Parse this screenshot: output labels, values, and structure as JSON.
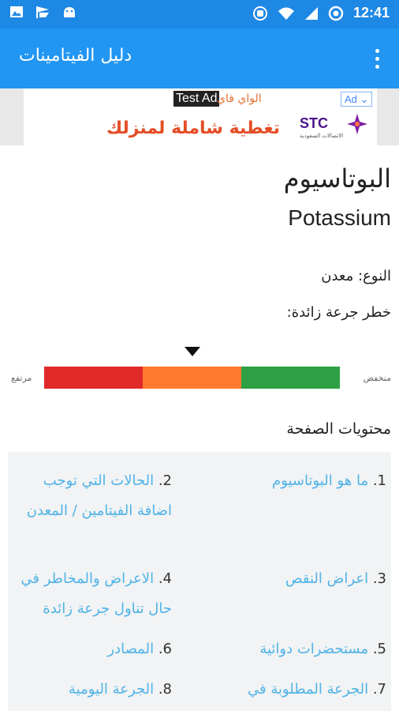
{
  "status_bar": {
    "time": "12:41",
    "left_icons": [
      "image-icon",
      "flag-icon",
      "android-icon"
    ],
    "right_icons": [
      "sync-icon",
      "wifi-icon",
      "signal-icon",
      "data-saver-icon"
    ]
  },
  "app_bar": {
    "title": "دليل الفيتامينات",
    "menu_icon": "more-vert-icon"
  },
  "ad": {
    "test_label": "Test Ad",
    "top_text": "الواي فاي",
    "main_text": "تغطية شاملة لمنزلك",
    "brand": "STC",
    "brand_sub": "الاتصالات السعودية",
    "choice_label": "Ad"
  },
  "nutrient": {
    "title_ar": "البوتاسيوم",
    "title_en": "Potassium",
    "type_line": "النوع: معدن",
    "overdose_risk_label": "خطر جرعة زائدة:"
  },
  "risk_meter": {
    "low_label": "منخفض",
    "high_label": "مرتفع",
    "level_fraction": 0.5,
    "colors": [
      "#2ea043",
      "#ff7a2f",
      "#e02a2a"
    ]
  },
  "contents": {
    "heading": "محتويات الصفحة",
    "items": [
      {
        "num": "1.",
        "text": "ما هو البوتاسيوم"
      },
      {
        "num": "2.",
        "text": "الحالات التي توجب اضافة الفيتامين / المعدن"
      },
      {
        "num": "3.",
        "text": "اعراض النقص"
      },
      {
        "num": "4.",
        "text": "الاعراض والمخاطر في حال تناول جرعة زائدة"
      },
      {
        "num": "5.",
        "text": "مستحضرات دوائية"
      },
      {
        "num": "6.",
        "text": "المصادر"
      },
      {
        "num": "7.",
        "text": "الجرعة المطلوبة في"
      },
      {
        "num": "8.",
        "text": "الجرعة اليومية"
      }
    ]
  },
  "colors": {
    "status_bar": "#1e88e5",
    "app_bar": "#2196f3",
    "link": "#4fb3e8"
  }
}
